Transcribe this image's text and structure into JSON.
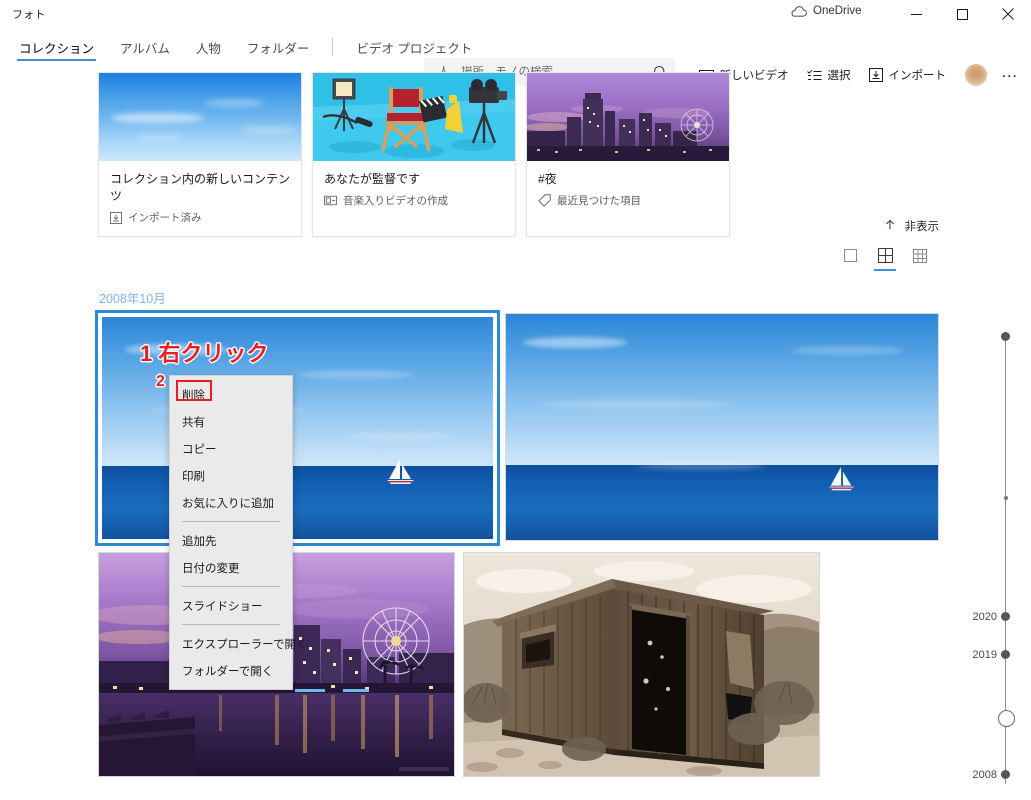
{
  "window": {
    "app_title": "フォト",
    "onedrive_label": "OneDrive",
    "minimize": "minimize",
    "maximize": "maximize",
    "close": "close"
  },
  "nav": {
    "tabs": [
      {
        "label": "コレクション",
        "active": true
      },
      {
        "label": "アルバム",
        "active": false
      },
      {
        "label": "人物",
        "active": false
      },
      {
        "label": "フォルダー",
        "active": false
      },
      {
        "label": "ビデオ プロジェクト",
        "active": false
      }
    ]
  },
  "search": {
    "placeholder": "人、場所、モノの検索...",
    "value": "",
    "icon": "search-icon"
  },
  "commands": [
    {
      "label": "新しいビデオ",
      "icon": "new-video-icon"
    },
    {
      "label": "選択",
      "icon": "select-checklist-icon"
    },
    {
      "label": "インポート",
      "icon": "import-icon"
    }
  ],
  "more_button": "…",
  "cards": [
    {
      "title": "コレクション内の新しいコンテンツ",
      "subtitle": "インポート済み",
      "icon": "import-icon",
      "thumb": "blue-sky"
    },
    {
      "title": "あなたが監督です",
      "subtitle": "音楽入りビデオの作成",
      "icon": "new-video-icon",
      "thumb": "film-studio-illustration"
    },
    {
      "title": "#夜",
      "subtitle": "最近見つけた項目",
      "icon": "tag-icon",
      "thumb": "night-cityscape"
    }
  ],
  "hide_row": {
    "label": "非表示",
    "icon": "chevron-up-icon"
  },
  "view_modes": [
    {
      "name": "single-view",
      "icon": "square-icon",
      "active": false
    },
    {
      "name": "grid-large-view",
      "icon": "grid-4-icon",
      "active": true
    },
    {
      "name": "grid-small-view",
      "icon": "grid-9-icon",
      "active": false
    }
  ],
  "date_header": "2008年10月",
  "photos": [
    {
      "name": "sailboat-seascape-1",
      "art": "seascape",
      "selected": true
    },
    {
      "name": "sailboat-seascape-2",
      "art": "seascape",
      "selected": false
    },
    {
      "name": "harbor-night-ferris-wheel",
      "art": "harbor",
      "selected": false
    },
    {
      "name": "sepia-wooden-shack",
      "art": "barn",
      "selected": false
    }
  ],
  "context_menu": {
    "items": [
      {
        "label": "削除",
        "highlighted": true
      },
      {
        "label": "共有",
        "highlighted": false
      },
      {
        "label": "コピー",
        "highlighted": false
      },
      {
        "label": "印刷",
        "highlighted": false
      },
      {
        "label": "お気に入りに追加",
        "highlighted": false
      },
      {
        "separator": true
      },
      {
        "label": "追加先",
        "highlighted": false
      },
      {
        "label": "日付の変更",
        "highlighted": false
      },
      {
        "separator": true
      },
      {
        "label": "スライドショー",
        "highlighted": false
      },
      {
        "separator": true
      },
      {
        "label": "エクスプローラーで開く",
        "highlighted": false
      },
      {
        "label": "フォルダーで開く",
        "highlighted": false
      }
    ]
  },
  "annotations": [
    {
      "text": "1 右クリック",
      "color": "#ec1c24"
    },
    {
      "text": "2",
      "color": "#ec1c24"
    }
  ],
  "timeline": {
    "labels": [
      "2020",
      "2019",
      "2008"
    ]
  },
  "colors": {
    "accent": "#3b8fe0",
    "annotation": "#ec1c24",
    "date_header": "#7cb6ea",
    "selection": "#2a8ad4"
  }
}
